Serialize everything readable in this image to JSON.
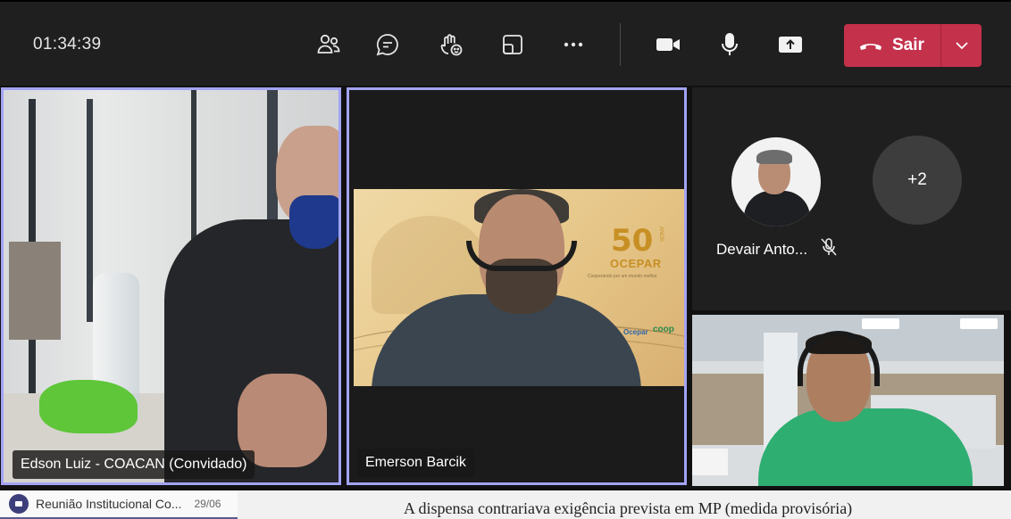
{
  "toolbar": {
    "timer": "01:34:39",
    "leave_label": "Sair",
    "icons": [
      "people-icon",
      "chat-icon",
      "raise-hand-icon",
      "rooms-icon",
      "more-icon",
      "camera-icon",
      "microphone-icon",
      "share-icon"
    ]
  },
  "participants": {
    "tile1_name": "Edson Luiz - COACAN (Convidado)",
    "tile2_name": "Emerson Barcik",
    "devair_name": "Devair Anto...",
    "overflow_count": "+2"
  },
  "background_logo": {
    "number": "50",
    "suffix": "ANOS",
    "name": "OCEPAR",
    "tagline": "Cooperando por um mundo melhor",
    "partner1": "Ocepar",
    "partner2": "coop"
  },
  "taskbar": {
    "item_label": "Reunião Institucional Co...",
    "item_date": "29/06",
    "background_text": "A dispensa contrariava exigência prevista em MP (medida provisória)"
  },
  "colors": {
    "leave": "#c4314b",
    "active_border": "#a3a3f5",
    "toolbar_bg": "#1f1f1f"
  }
}
